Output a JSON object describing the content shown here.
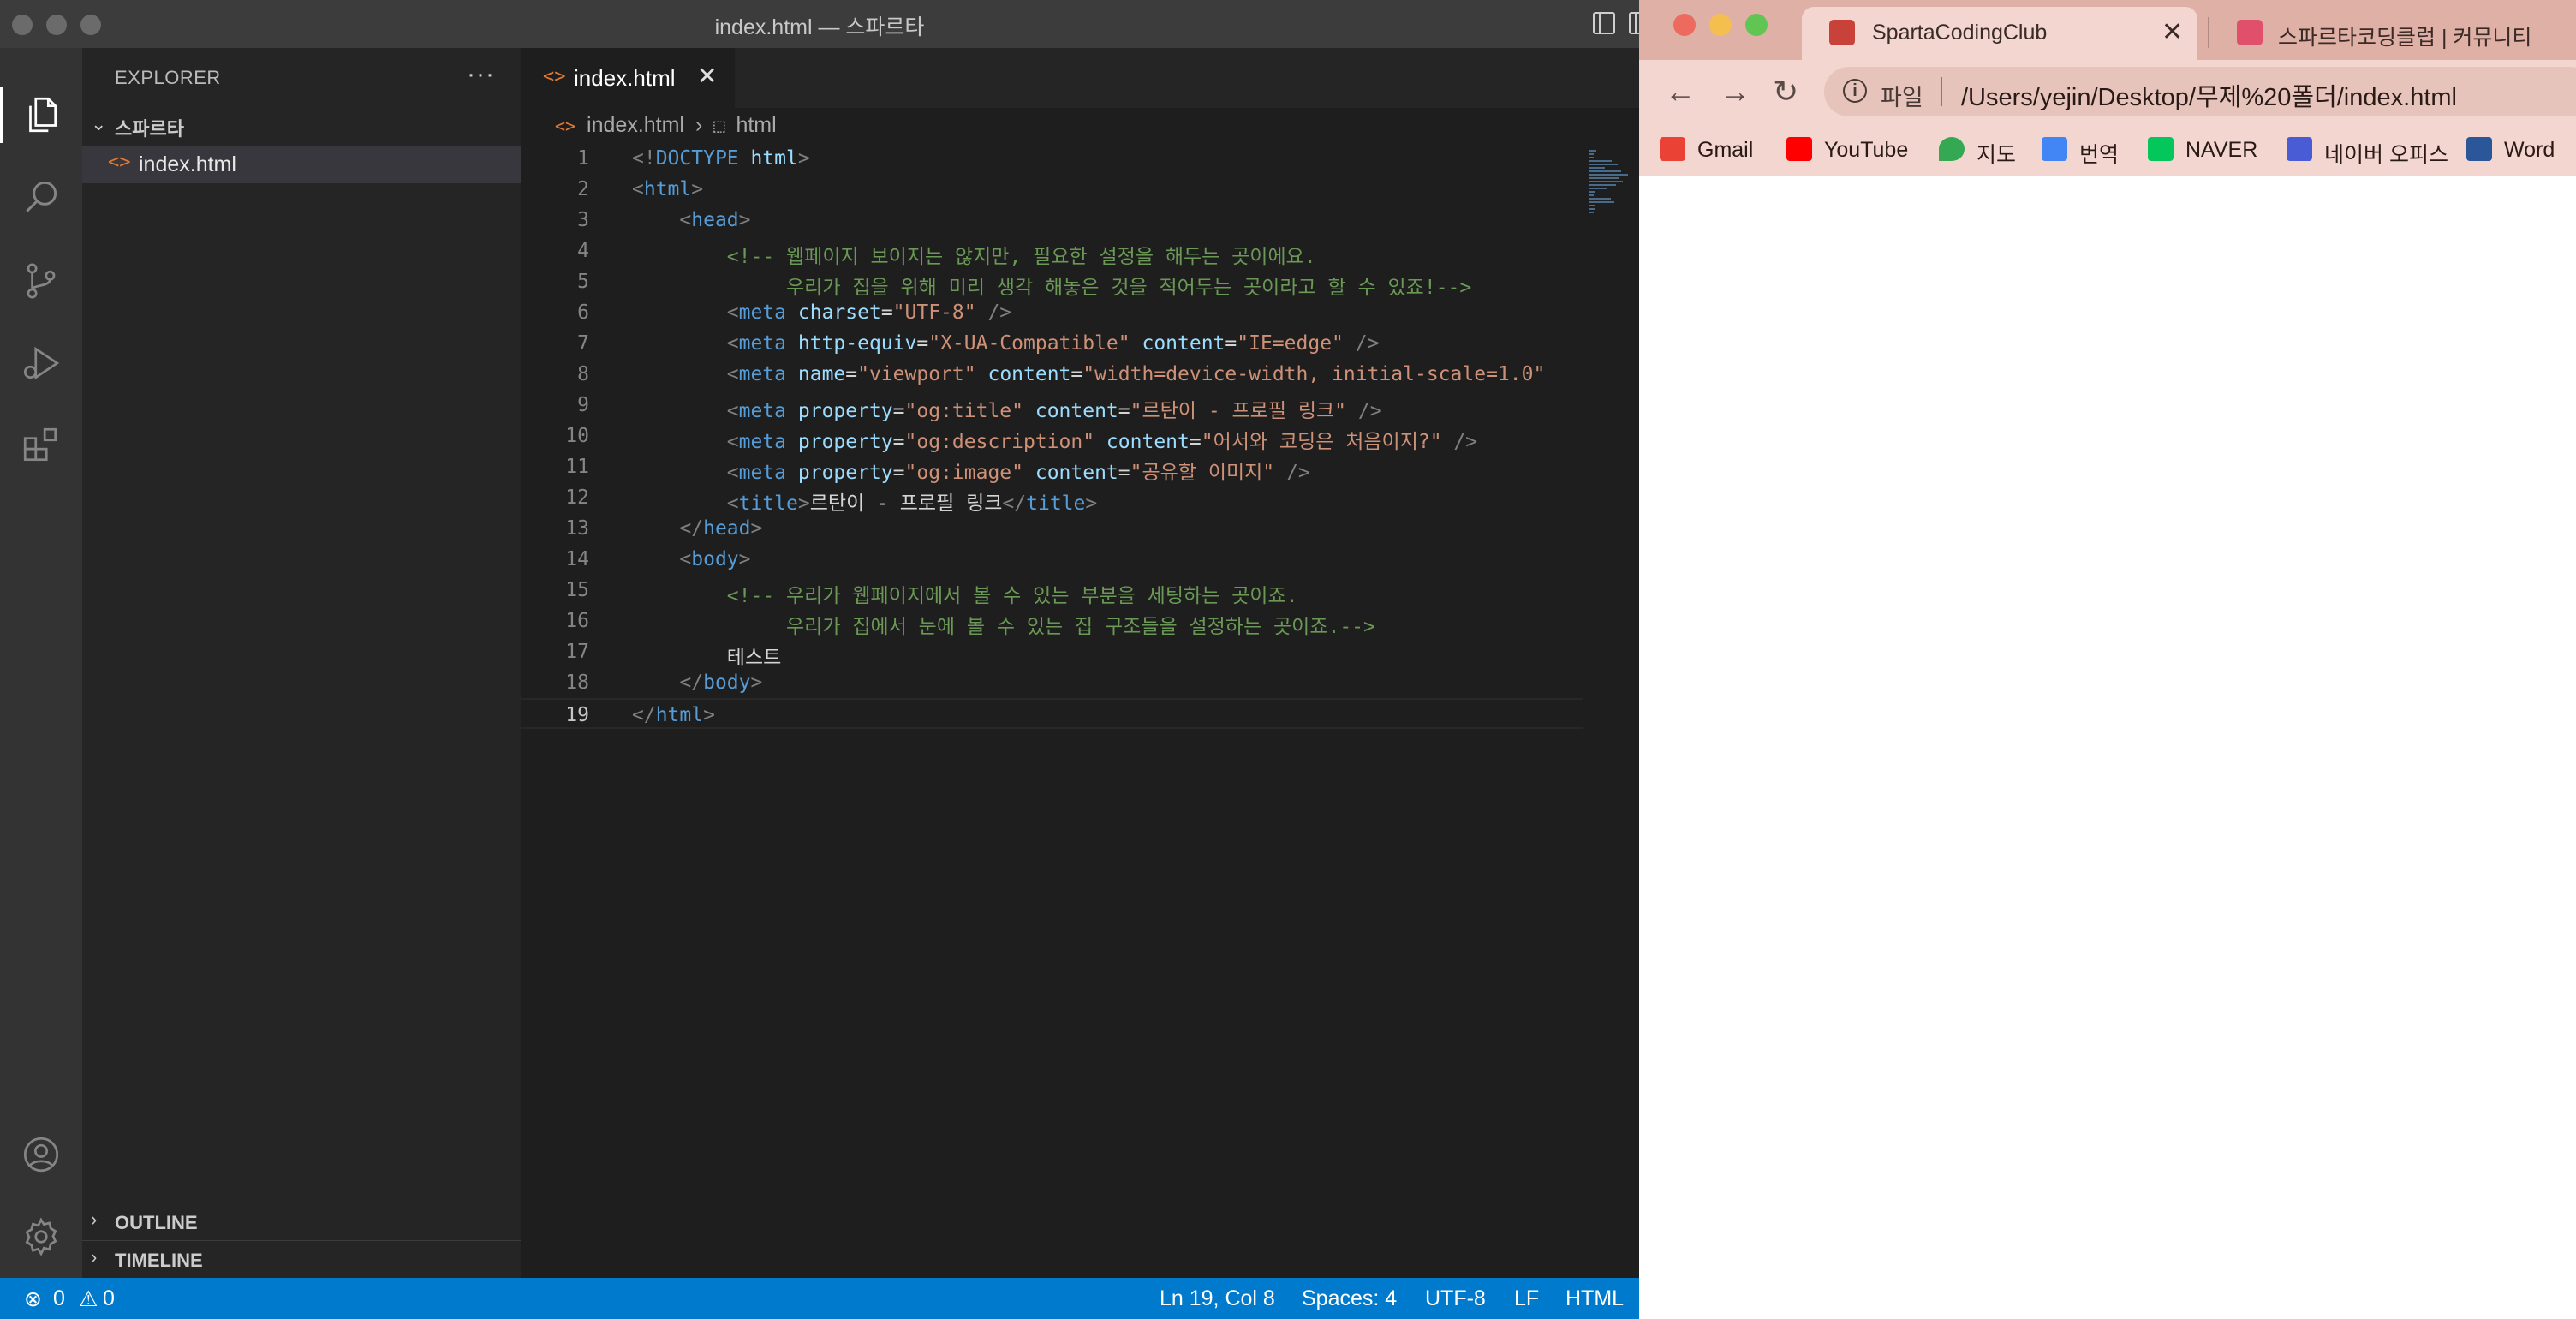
{
  "vscode": {
    "window_title": "index.html — 스파르타",
    "explorer": {
      "title": "EXPLORER",
      "more": "···",
      "folder": "스파르타",
      "files": [
        {
          "name": "index.html",
          "icon": "<>"
        }
      ],
      "panels": [
        {
          "label": "OUTLINE"
        },
        {
          "label": "TIMELINE"
        }
      ]
    },
    "activity_bar": [
      "explorer-icon",
      "search-icon",
      "source-control-icon",
      "run-debug-icon",
      "extensions-icon",
      "account-icon",
      "settings-gear-icon"
    ],
    "tab": {
      "icon": "<>",
      "label": "index.html",
      "close": "✕"
    },
    "breadcrumb": {
      "icon": "<>",
      "file": "index.html",
      "sep": "›",
      "sym_icon": "⬚",
      "symbol": "html"
    },
    "lines": [
      {
        "n": "1",
        "tokens": [
          {
            "t": "<!",
            "c": "br"
          },
          {
            "t": "DOCTYPE",
            "c": "tag"
          },
          {
            "t": " html",
            "c": "attr"
          },
          {
            "t": ">",
            "c": "br"
          }
        ]
      },
      {
        "n": "2",
        "tokens": [
          {
            "t": "<",
            "c": "br"
          },
          {
            "t": "html",
            "c": "tag"
          },
          {
            "t": ">",
            "c": "br"
          }
        ]
      },
      {
        "n": "3",
        "tokens": [
          {
            "t": "    ",
            "c": "txt"
          },
          {
            "t": "<",
            "c": "br"
          },
          {
            "t": "head",
            "c": "tag"
          },
          {
            "t": ">",
            "c": "br"
          }
        ]
      },
      {
        "n": "4",
        "tokens": [
          {
            "t": "        ",
            "c": "txt"
          },
          {
            "t": "<!-- 웹페이지 보이지는 않지만, 필요한 설정을 해두는 곳이에요.",
            "c": "com"
          }
        ]
      },
      {
        "n": "5",
        "tokens": [
          {
            "t": "             ",
            "c": "txt"
          },
          {
            "t": "우리가 집을 위해 미리 생각 해놓은 것을 적어두는 곳이라고 할 수 있죠!-->",
            "c": "com"
          }
        ]
      },
      {
        "n": "6",
        "tokens": [
          {
            "t": "        ",
            "c": "txt"
          },
          {
            "t": "<",
            "c": "br"
          },
          {
            "t": "meta",
            "c": "tag"
          },
          {
            "t": " charset",
            "c": "attr"
          },
          {
            "t": "=",
            "c": "txt"
          },
          {
            "t": "\"UTF-8\"",
            "c": "str"
          },
          {
            "t": " />",
            "c": "br"
          }
        ]
      },
      {
        "n": "7",
        "tokens": [
          {
            "t": "        ",
            "c": "txt"
          },
          {
            "t": "<",
            "c": "br"
          },
          {
            "t": "meta",
            "c": "tag"
          },
          {
            "t": " http-equiv",
            "c": "attr"
          },
          {
            "t": "=",
            "c": "txt"
          },
          {
            "t": "\"X-UA-Compatible\"",
            "c": "str"
          },
          {
            "t": " content",
            "c": "attr"
          },
          {
            "t": "=",
            "c": "txt"
          },
          {
            "t": "\"IE=edge\"",
            "c": "str"
          },
          {
            "t": " />",
            "c": "br"
          }
        ]
      },
      {
        "n": "8",
        "tokens": [
          {
            "t": "        ",
            "c": "txt"
          },
          {
            "t": "<",
            "c": "br"
          },
          {
            "t": "meta",
            "c": "tag"
          },
          {
            "t": " name",
            "c": "attr"
          },
          {
            "t": "=",
            "c": "txt"
          },
          {
            "t": "\"viewport\"",
            "c": "str"
          },
          {
            "t": " content",
            "c": "attr"
          },
          {
            "t": "=",
            "c": "txt"
          },
          {
            "t": "\"width=device-width, initial-scale=1.0\"",
            "c": "str"
          }
        ]
      },
      {
        "n": "9",
        "tokens": [
          {
            "t": "        ",
            "c": "txt"
          },
          {
            "t": "<",
            "c": "br"
          },
          {
            "t": "meta",
            "c": "tag"
          },
          {
            "t": " property",
            "c": "attr"
          },
          {
            "t": "=",
            "c": "txt"
          },
          {
            "t": "\"og:title\"",
            "c": "str"
          },
          {
            "t": " content",
            "c": "attr"
          },
          {
            "t": "=",
            "c": "txt"
          },
          {
            "t": "\"르탄이 - 프로필 링크\"",
            "c": "str"
          },
          {
            "t": " />",
            "c": "br"
          }
        ]
      },
      {
        "n": "10",
        "tokens": [
          {
            "t": "        ",
            "c": "txt"
          },
          {
            "t": "<",
            "c": "br"
          },
          {
            "t": "meta",
            "c": "tag"
          },
          {
            "t": " property",
            "c": "attr"
          },
          {
            "t": "=",
            "c": "txt"
          },
          {
            "t": "\"og:description\"",
            "c": "str"
          },
          {
            "t": " content",
            "c": "attr"
          },
          {
            "t": "=",
            "c": "txt"
          },
          {
            "t": "\"어서와 코딩은 처음이지?\"",
            "c": "str"
          },
          {
            "t": " />",
            "c": "br"
          }
        ]
      },
      {
        "n": "11",
        "tokens": [
          {
            "t": "        ",
            "c": "txt"
          },
          {
            "t": "<",
            "c": "br"
          },
          {
            "t": "meta",
            "c": "tag"
          },
          {
            "t": " property",
            "c": "attr"
          },
          {
            "t": "=",
            "c": "txt"
          },
          {
            "t": "\"og:image\"",
            "c": "str"
          },
          {
            "t": " content",
            "c": "attr"
          },
          {
            "t": "=",
            "c": "txt"
          },
          {
            "t": "\"공유할 이미지\"",
            "c": "str"
          },
          {
            "t": " />",
            "c": "br"
          }
        ]
      },
      {
        "n": "12",
        "tokens": [
          {
            "t": "        ",
            "c": "txt"
          },
          {
            "t": "<",
            "c": "br"
          },
          {
            "t": "title",
            "c": "tag"
          },
          {
            "t": ">",
            "c": "br"
          },
          {
            "t": "르탄이 - 프로필 링크",
            "c": "txt"
          },
          {
            "t": "</",
            "c": "br"
          },
          {
            "t": "title",
            "c": "tag"
          },
          {
            "t": ">",
            "c": "br"
          }
        ]
      },
      {
        "n": "13",
        "tokens": [
          {
            "t": "    ",
            "c": "txt"
          },
          {
            "t": "</",
            "c": "br"
          },
          {
            "t": "head",
            "c": "tag"
          },
          {
            "t": ">",
            "c": "br"
          }
        ]
      },
      {
        "n": "14",
        "tokens": [
          {
            "t": "    ",
            "c": "txt"
          },
          {
            "t": "<",
            "c": "br"
          },
          {
            "t": "body",
            "c": "tag"
          },
          {
            "t": ">",
            "c": "br"
          }
        ]
      },
      {
        "n": "15",
        "tokens": [
          {
            "t": "        ",
            "c": "txt"
          },
          {
            "t": "<!-- 우리가 웹페이지에서 볼 수 있는 부분을 세팅하는 곳이죠.",
            "c": "com"
          }
        ]
      },
      {
        "n": "16",
        "tokens": [
          {
            "t": "             ",
            "c": "txt"
          },
          {
            "t": "우리가 집에서 눈에 볼 수 있는 집 구조들을 설정하는 곳이죠.-->",
            "c": "com"
          }
        ]
      },
      {
        "n": "17",
        "tokens": [
          {
            "t": "        ",
            "c": "txt"
          },
          {
            "t": "테스트",
            "c": "txt"
          }
        ]
      },
      {
        "n": "18",
        "tokens": [
          {
            "t": "    ",
            "c": "txt"
          },
          {
            "t": "</",
            "c": "br"
          },
          {
            "t": "body",
            "c": "tag"
          },
          {
            "t": ">",
            "c": "br"
          }
        ]
      },
      {
        "n": "19",
        "tokens": [
          {
            "t": "</",
            "c": "br"
          },
          {
            "t": "html",
            "c": "tag"
          },
          {
            "t": ">",
            "c": "br"
          }
        ]
      }
    ],
    "status": {
      "errors_icon": "⊗",
      "errors": "0",
      "warnings_icon": "⚠",
      "warnings": "0",
      "position": "Ln 19, Col 8",
      "spaces": "Spaces: 4",
      "encoding": "UTF-8",
      "eol": "LF",
      "language": "HTML"
    },
    "colors": {
      "statusbar": "#007acc",
      "activity": "#333333",
      "sidebar": "#252526",
      "editor": "#1e1e1e"
    }
  },
  "chrome": {
    "tabs": [
      {
        "title": "SpartaCodingClub",
        "close": "✕",
        "active": true,
        "favicon": "sparta-favicon"
      },
      {
        "title": "스파르타코딩클럽 | 커뮤니티",
        "active": false,
        "favicon": "sparta-community-favicon"
      }
    ],
    "nav": {
      "back": "←",
      "forward": "→",
      "reload": "↻"
    },
    "omnibox": {
      "info": "i",
      "scheme": "파일",
      "url": "/Users/yejin/Desktop/무제%20폴더/index.html"
    },
    "bookmarks": [
      {
        "label": "Gmail",
        "icon": "gmail-icon",
        "color": "#ea4335"
      },
      {
        "label": "YouTube",
        "icon": "youtube-icon",
        "color": "#ff0000"
      },
      {
        "label": "지도",
        "icon": "maps-icon",
        "color": "#34a853"
      },
      {
        "label": "번역",
        "icon": "translate-icon",
        "color": "#4285f4"
      },
      {
        "label": "NAVER",
        "icon": "naver-icon",
        "color": "#03c75a"
      },
      {
        "label": "네이버 오피스",
        "icon": "naver-office-icon",
        "color": "#4a5bd6"
      },
      {
        "label": "Word",
        "icon": "word-icon",
        "color": "#2b579a"
      }
    ],
    "colors": {
      "frame": "#dfb0a5",
      "toolbar": "#f2d6cf"
    }
  }
}
